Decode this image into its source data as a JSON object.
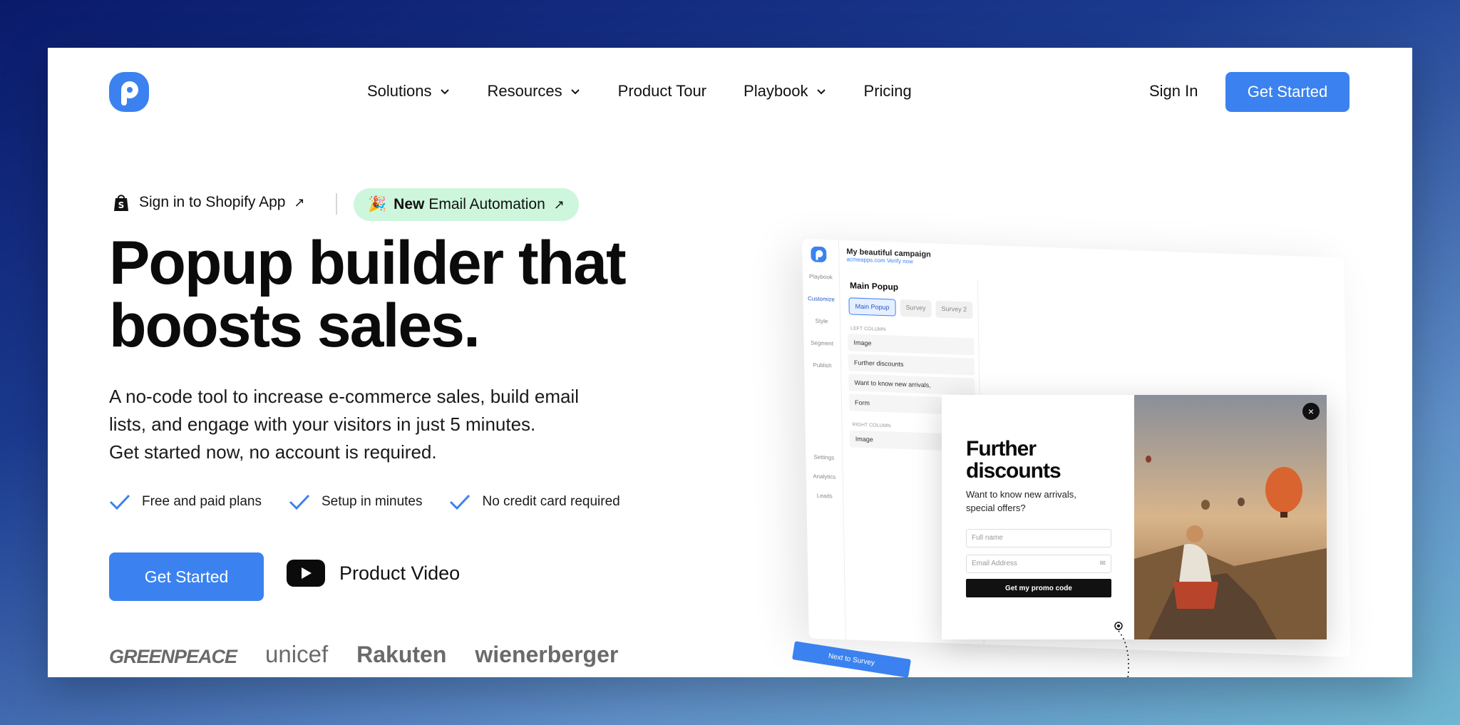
{
  "nav": {
    "items": [
      {
        "label": "Solutions",
        "has_dropdown": true
      },
      {
        "label": "Resources",
        "has_dropdown": true
      },
      {
        "label": "Product Tour",
        "has_dropdown": false
      },
      {
        "label": "Playbook",
        "has_dropdown": true
      },
      {
        "label": "Pricing",
        "has_dropdown": false
      }
    ],
    "signin_label": "Sign In",
    "cta_label": "Get Started"
  },
  "hero": {
    "shopify_link": "Sign in to Shopify App",
    "pill_emoji": "🎉",
    "pill_new": "New",
    "pill_text": "Email Automation",
    "title_line1": "Popup builder that",
    "title_line2": "boosts sales.",
    "sub_line1": "A no-code tool to increase e-commerce sales, build email",
    "sub_line2": "lists, and engage with your visitors in just 5 minutes.",
    "sub_line3": "Get started now, no account is required.",
    "checks": [
      "Free and paid plans",
      "Setup in minutes",
      "No credit card required"
    ],
    "cta_label": "Get Started",
    "video_label": "Product Video"
  },
  "logos": [
    "GREENPEACE",
    "unicef",
    "Rakuten",
    "wienerberger"
  ],
  "mockup": {
    "campaign_title": "My beautiful campaign",
    "campaign_url": "acmeapps.com  Verify now",
    "panel_title": "Main Popup",
    "tabs": [
      "Main Popup",
      "Survey",
      "Survey 2"
    ],
    "left_column_label": "LEFT COLUMN",
    "left_rows": [
      "Image",
      "Further discounts",
      "Want to know new arrivals,",
      "Form"
    ],
    "right_column_label": "RIGHT COLUMN",
    "right_rows": [
      "Image"
    ],
    "rail": [
      "Playbook",
      "Customize",
      "Style",
      "Segment",
      "Publish",
      "Settings",
      "Analytics",
      "Leads"
    ],
    "next_label": "Next to Survey"
  },
  "popup": {
    "title_line1": "Further",
    "title_line2": "discounts",
    "text_line1": "Want to know new arrivals,",
    "text_line2": "special offers?",
    "fullname_placeholder": "Full name",
    "email_placeholder": "Email Address",
    "button_label": "Get my promo code",
    "close": "×"
  },
  "colors": {
    "accent": "#3b82f0",
    "pill_bg": "#cdf6dc"
  }
}
